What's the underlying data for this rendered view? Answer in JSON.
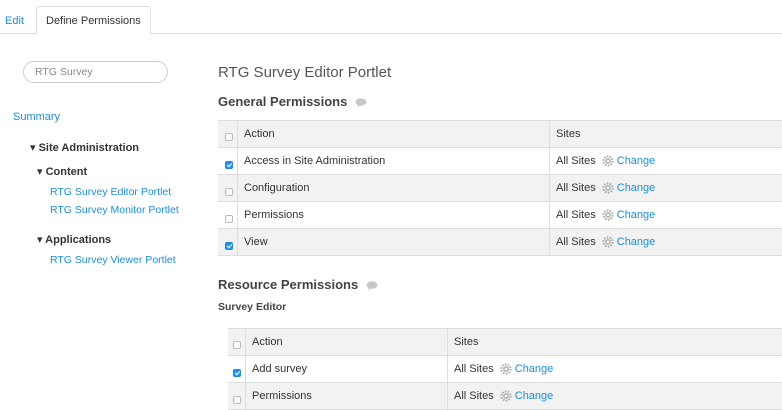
{
  "tabs": {
    "edit": "Edit",
    "define_permissions": "Define Permissions"
  },
  "sidebar": {
    "search_value": "RTG Survey",
    "summary": "Summary",
    "site_admin": "▾ Site Administration",
    "content": "▾ Content",
    "content_items": [
      "RTG Survey Editor Portlet",
      "RTG Survey Monitor Portlet"
    ],
    "applications": "▾ Applications",
    "application_items": [
      "RTG Survey Viewer Portlet"
    ]
  },
  "main": {
    "portlet_title": "RTG Survey Editor Portlet",
    "general_title": "General Permissions",
    "resource_title": "Resource Permissions",
    "survey_editor": "Survey Editor",
    "col_action": "Action",
    "col_sites": "Sites",
    "all_sites": "All Sites",
    "change": "Change",
    "general_rows": [
      {
        "action": "Access in Site Administration",
        "checked": true
      },
      {
        "action": "Configuration",
        "checked": false
      },
      {
        "action": "Permissions",
        "checked": false
      },
      {
        "action": "View",
        "checked": true
      }
    ],
    "resource_rows": [
      {
        "action": "Add survey",
        "checked": true
      },
      {
        "action": "Permissions",
        "checked": false
      }
    ]
  },
  "colors": {
    "link": "#1a8ed8",
    "checkbox_on": "#2196f3"
  },
  "icons": {
    "help": "speech-bubble-icon",
    "change": "gear-icon",
    "expand": "triangle-down-icon"
  }
}
